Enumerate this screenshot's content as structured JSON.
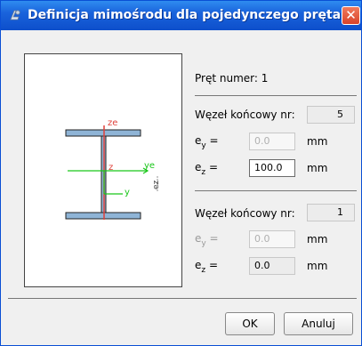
{
  "window": {
    "title": "Definicja mimośrodu dla pojedynczego pręta",
    "close_label": "✕"
  },
  "figure": {
    "label_ze_top": "ze",
    "label_ye": "ye",
    "label_z": "z",
    "label_y": "y",
    "label_ze_rotated": "ez"
  },
  "bar": {
    "label": "Pręt numer: 1"
  },
  "node_end_1": {
    "label": "Węzeł końcowy nr:",
    "value": "5",
    "ey_label": "e",
    "ey_sub": "y",
    "ey_eq": "=",
    "ey_value": "0.0",
    "ey_unit": "mm",
    "ez_label": "e",
    "ez_sub": "z",
    "ez_eq": "=",
    "ez_value": "100.0",
    "ez_unit": "mm"
  },
  "node_end_2": {
    "label": "Węzeł końcowy nr:",
    "value": "1",
    "ey_label": "e",
    "ey_sub": "y",
    "ey_eq": "=",
    "ey_value": "0.0",
    "ey_unit": "mm",
    "ez_label": "e",
    "ez_sub": "z",
    "ez_eq": "=",
    "ez_value": "0.0",
    "ez_unit": "mm"
  },
  "buttons": {
    "ok": "OK",
    "cancel": "Anuluj"
  },
  "colors": {
    "titlebar": "#1a63dc",
    "flange": "#8fb4d6",
    "web": "#b06070",
    "axis_red": "#e0403a",
    "axis_green": "#19c619"
  }
}
